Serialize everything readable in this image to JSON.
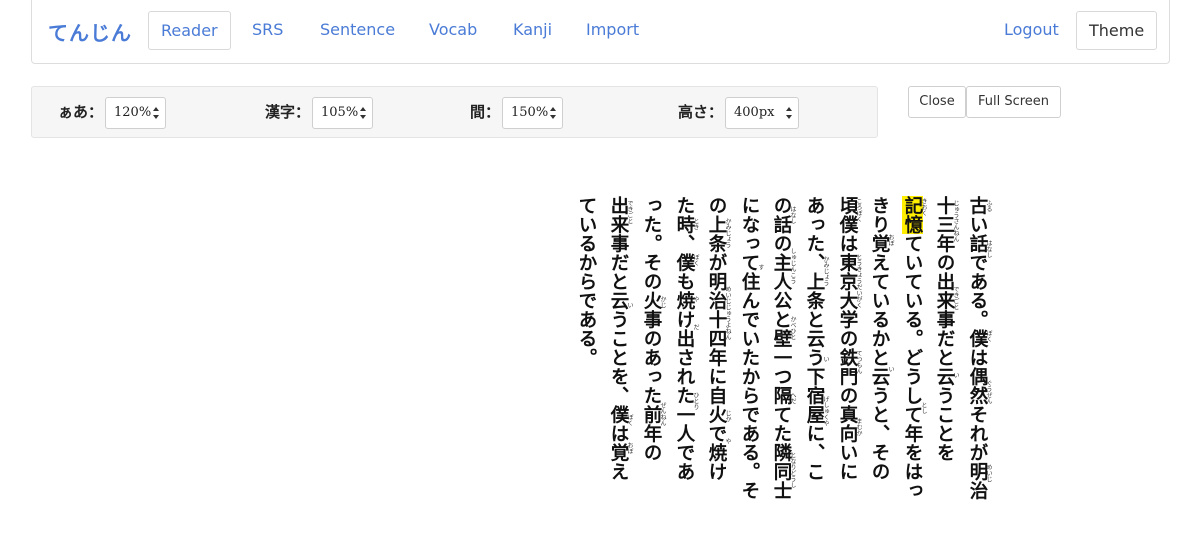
{
  "nav": {
    "brand": "てんじん",
    "items": [
      "Reader",
      "SRS",
      "Sentence",
      "Vocab",
      "Kanji",
      "Import"
    ],
    "logout": "Logout",
    "theme": "Theme"
  },
  "toolbar": {
    "font_size": {
      "label": "ぁあ：",
      "value": "120%"
    },
    "kanji_size": {
      "label": "漢字：",
      "value": "105%"
    },
    "spacing": {
      "label": "間：",
      "value": "150%"
    },
    "height": {
      "label": "高さ：",
      "value": "400px"
    }
  },
  "buttons": {
    "close": "Close",
    "full_screen": "Full Screen"
  },
  "reader": {
    "highlight_word": "記憶",
    "columns": [
      "古い話である。僕は偶然それが明治",
      "十三年の出来事だと云うことを",
      "していている。どうして年をはっ",
      "きり覚えているかと云うと、その",
      "頃僕は東京大学の鉄門の真向いに",
      "あった、上条と云う下宿屋に、こ",
      "の話の主人公と壁一つ隔てた隣同士",
      "になって住んでいたからである。そ",
      "の上条が明治十四年に自火で焼け",
      "た時、僕も焼け出された一人であ",
      "った。その火事のあった前年の",
      "出来事だと云うことを、僕は覚え",
      "ているからである。"
    ],
    "rubies": [
      "ふる",
      "はなし",
      "ぼく",
      "ぐうぜん",
      "めいじ",
      "じゅうさんねん",
      "できごと",
      "い",
      "きおく",
      "とし",
      "おぼ",
      "い",
      "ころぼく",
      "とうきょうだいがく",
      "てつもん",
      "まむか",
      "かみじょう",
      "い",
      "げしゅくや",
      "はなし",
      "しゅじんこう",
      "かべひと",
      "へだ",
      "となりどうし",
      "す",
      "かみじょう",
      "めいじじゅうよねん",
      "じか",
      "や",
      "とき",
      "ぼく",
      "や",
      "だ",
      "ひとり",
      "かじ",
      "ぜんねん",
      "できごと",
      "い",
      "ぼく",
      "おぼ"
    ]
  }
}
